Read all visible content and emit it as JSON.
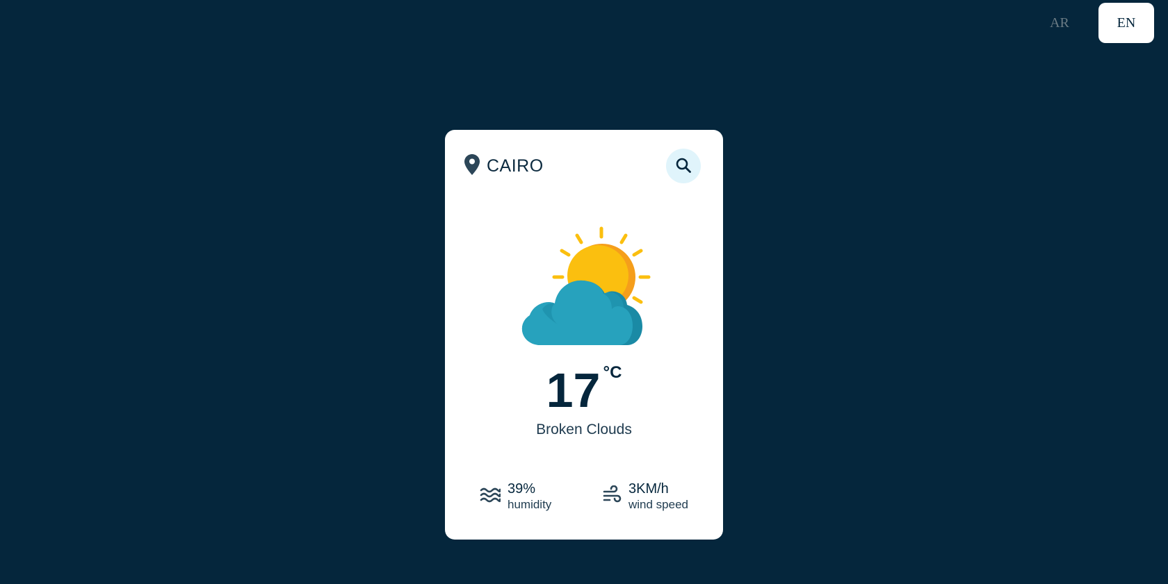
{
  "languages": {
    "ar_label": "AR",
    "en_label": "EN",
    "active": "EN"
  },
  "weather": {
    "city": "CAIRO",
    "temperature": "17",
    "unit": "°C",
    "condition": "Broken Clouds",
    "humidity_value": "39%",
    "humidity_label": "humidity",
    "wind_value": "3KM/h",
    "wind_label": "wind speed",
    "icon": "sun-behind-cloud-icon"
  },
  "colors": {
    "background": "#05263c",
    "card": "#ffffff",
    "search_bg": "#e0f4fb",
    "sun": "#fbbf0f",
    "sun_shade": "#f59e1b",
    "cloud": "#27a2bd",
    "cloud_shade": "#1a8aa5"
  }
}
